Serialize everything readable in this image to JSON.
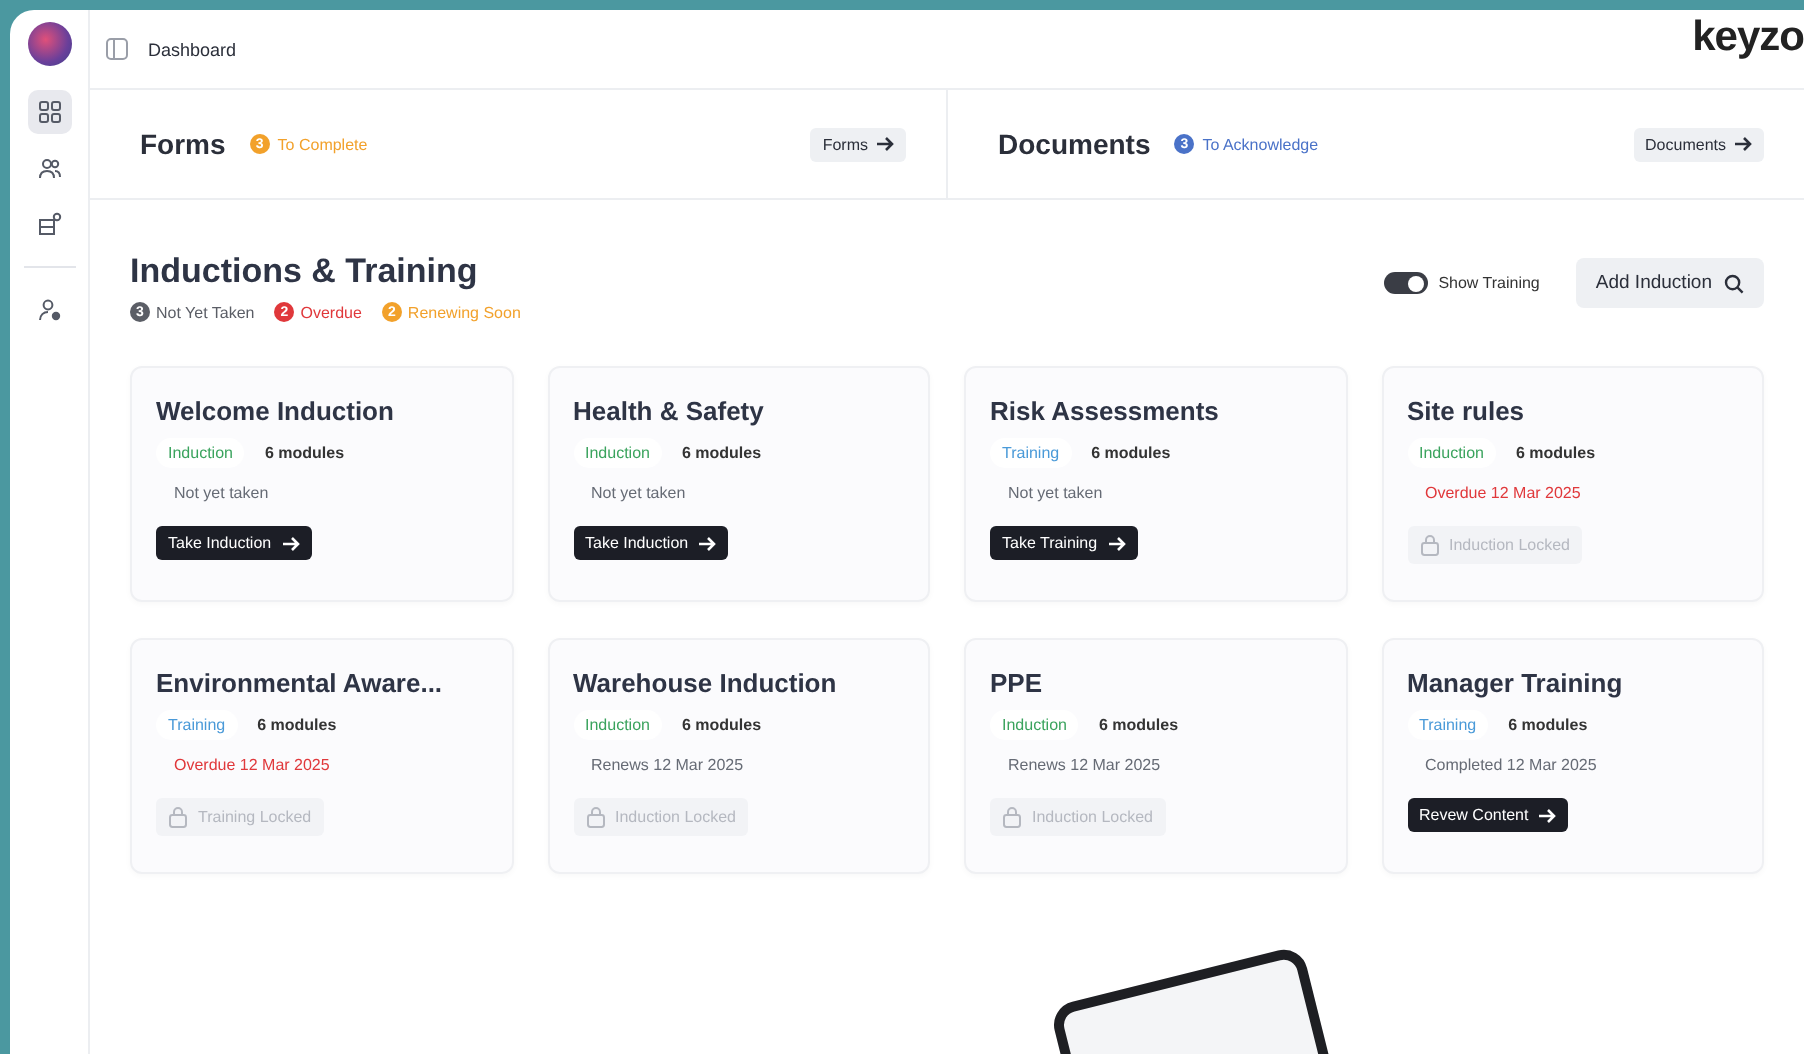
{
  "sidebar": {
    "items": [
      {
        "kind": "grid",
        "selected": true
      },
      {
        "kind": "people",
        "selected": false
      },
      {
        "kind": "blocks",
        "selected": false
      },
      {
        "kind": "user-settings",
        "selected": false
      }
    ]
  },
  "topbar": {
    "title": "Dashboard",
    "logo": "keyzo"
  },
  "summary": [
    {
      "title": "Forms",
      "count": "3",
      "label": "To Complete",
      "color": "#f2a12b",
      "button": "Forms"
    },
    {
      "title": "Documents",
      "count": "3",
      "label": "To Acknowledge",
      "color": "#4a72c8",
      "button": "Documents"
    }
  ],
  "section": {
    "title": "Inductions & Training",
    "legend": [
      {
        "count": "3",
        "label": "Not Yet Taken",
        "color": "#5b5e66"
      },
      {
        "count": "2",
        "label": "Overdue",
        "color": "#e0383b"
      },
      {
        "count": "2",
        "label": "Renewing Soon",
        "color": "#f2a12b"
      }
    ],
    "toggle": {
      "label": "Show Training",
      "on": true
    },
    "add_button": "Add Induction"
  },
  "cards": [
    {
      "title": "Welcome Induction",
      "tag": {
        "label": "Induction",
        "kind": "induction"
      },
      "modules": "6 modules",
      "status": {
        "text": "Not yet taken",
        "kind": "pending"
      },
      "action": {
        "label": "Take Induction",
        "kind": "start"
      }
    },
    {
      "title": "Health & Safety",
      "tag": {
        "label": "Induction",
        "kind": "induction"
      },
      "modules": "6 modules",
      "status": {
        "text": "Not yet taken",
        "kind": "pending"
      },
      "action": {
        "label": "Take Induction",
        "kind": "start"
      }
    },
    {
      "title": "Risk Assessments",
      "tag": {
        "label": "Training",
        "kind": "training"
      },
      "modules": "6 modules",
      "status": {
        "text": "Not yet taken",
        "kind": "pending"
      },
      "action": {
        "label": "Take Training",
        "kind": "start"
      }
    },
    {
      "title": "Site rules",
      "tag": {
        "label": "Induction",
        "kind": "induction"
      },
      "modules": "6 modules",
      "status": {
        "text": "Overdue 12 Mar 2025",
        "kind": "overdue"
      },
      "action": {
        "label": "Induction Locked",
        "kind": "locked"
      }
    },
    {
      "title": "Environmental Aware...",
      "tag": {
        "label": "Training",
        "kind": "training"
      },
      "modules": "6 modules",
      "status": {
        "text": "Overdue 12 Mar 2025",
        "kind": "overdue"
      },
      "action": {
        "label": "Training Locked",
        "kind": "locked"
      }
    },
    {
      "title": "Warehouse Induction",
      "tag": {
        "label": "Induction",
        "kind": "induction"
      },
      "modules": "6 modules",
      "status": {
        "text": "Renews 12 Mar 2025",
        "kind": "renews"
      },
      "action": {
        "label": "Induction Locked",
        "kind": "locked"
      }
    },
    {
      "title": "PPE",
      "tag": {
        "label": "Induction",
        "kind": "induction"
      },
      "modules": "6 modules",
      "status": {
        "text": "Renews 12 Mar 2025",
        "kind": "renews"
      },
      "action": {
        "label": "Induction Locked",
        "kind": "locked"
      }
    },
    {
      "title": "Manager Training",
      "tag": {
        "label": "Training",
        "kind": "training"
      },
      "modules": "6 modules",
      "status": {
        "text": "Completed 12 Mar 2025",
        "kind": "completed"
      },
      "action": {
        "label": "Revew Content",
        "kind": "start"
      }
    }
  ]
}
